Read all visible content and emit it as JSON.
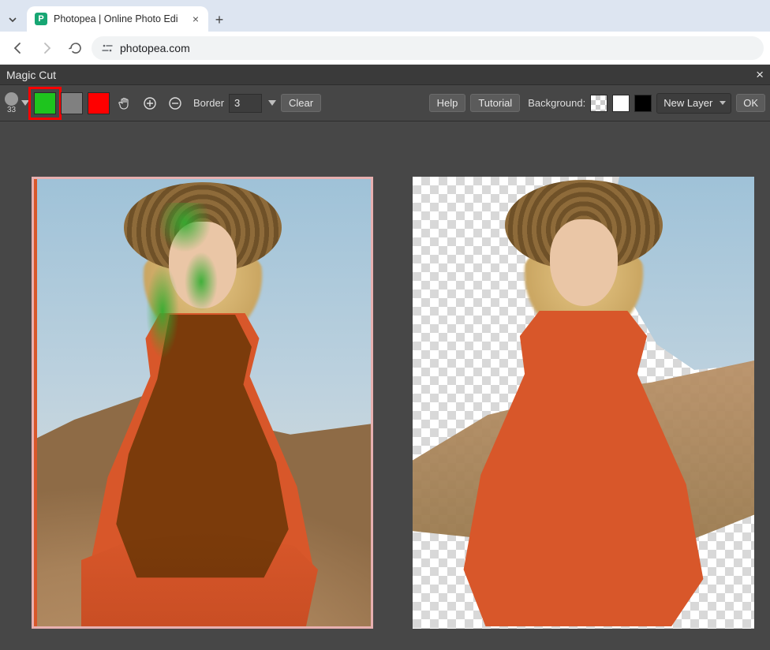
{
  "browser": {
    "tab_title": "Photopea | Online Photo Edi",
    "url": "photopea.com"
  },
  "dialog": {
    "title": "Magic Cut",
    "brush_size": "33",
    "border_label": "Border",
    "border_value": "3",
    "clear_label": "Clear",
    "help_label": "Help",
    "tutorial_label": "Tutorial",
    "background_label": "Background:",
    "layer_select": "New Layer",
    "ok_label": "OK"
  },
  "colors": {
    "foreground_swatch": "#1ec41e",
    "neutral_swatch": "#808080",
    "background_swatch": "#ff0000"
  }
}
